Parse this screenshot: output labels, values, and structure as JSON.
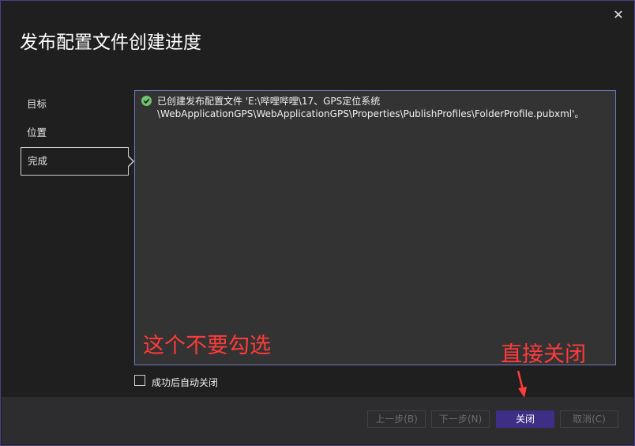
{
  "window": {
    "title": "发布配置文件创建进度"
  },
  "steps": [
    {
      "label": "目标"
    },
    {
      "label": "位置"
    },
    {
      "label": "完成"
    }
  ],
  "log": {
    "message": "已创建发布配置文件 'E:\\哔哩哔哩\\17、GPS定位系统\\WebApplicationGPS\\WebApplicationGPS\\Properties\\PublishProfiles\\FolderProfile.pubxml'。"
  },
  "options": {
    "close_on_success_label": "成功后自动关闭"
  },
  "annotations": {
    "dont_check": "这个不要勾选",
    "close_directly": "直接关闭"
  },
  "buttons": {
    "prev": "上一步(B)",
    "next": "下一步(N)",
    "close": "关闭",
    "cancel": "取消(C)"
  },
  "colors": {
    "accent": "#3e2e86",
    "annotation": "#ff3b3b",
    "success": "#6ec46e"
  }
}
